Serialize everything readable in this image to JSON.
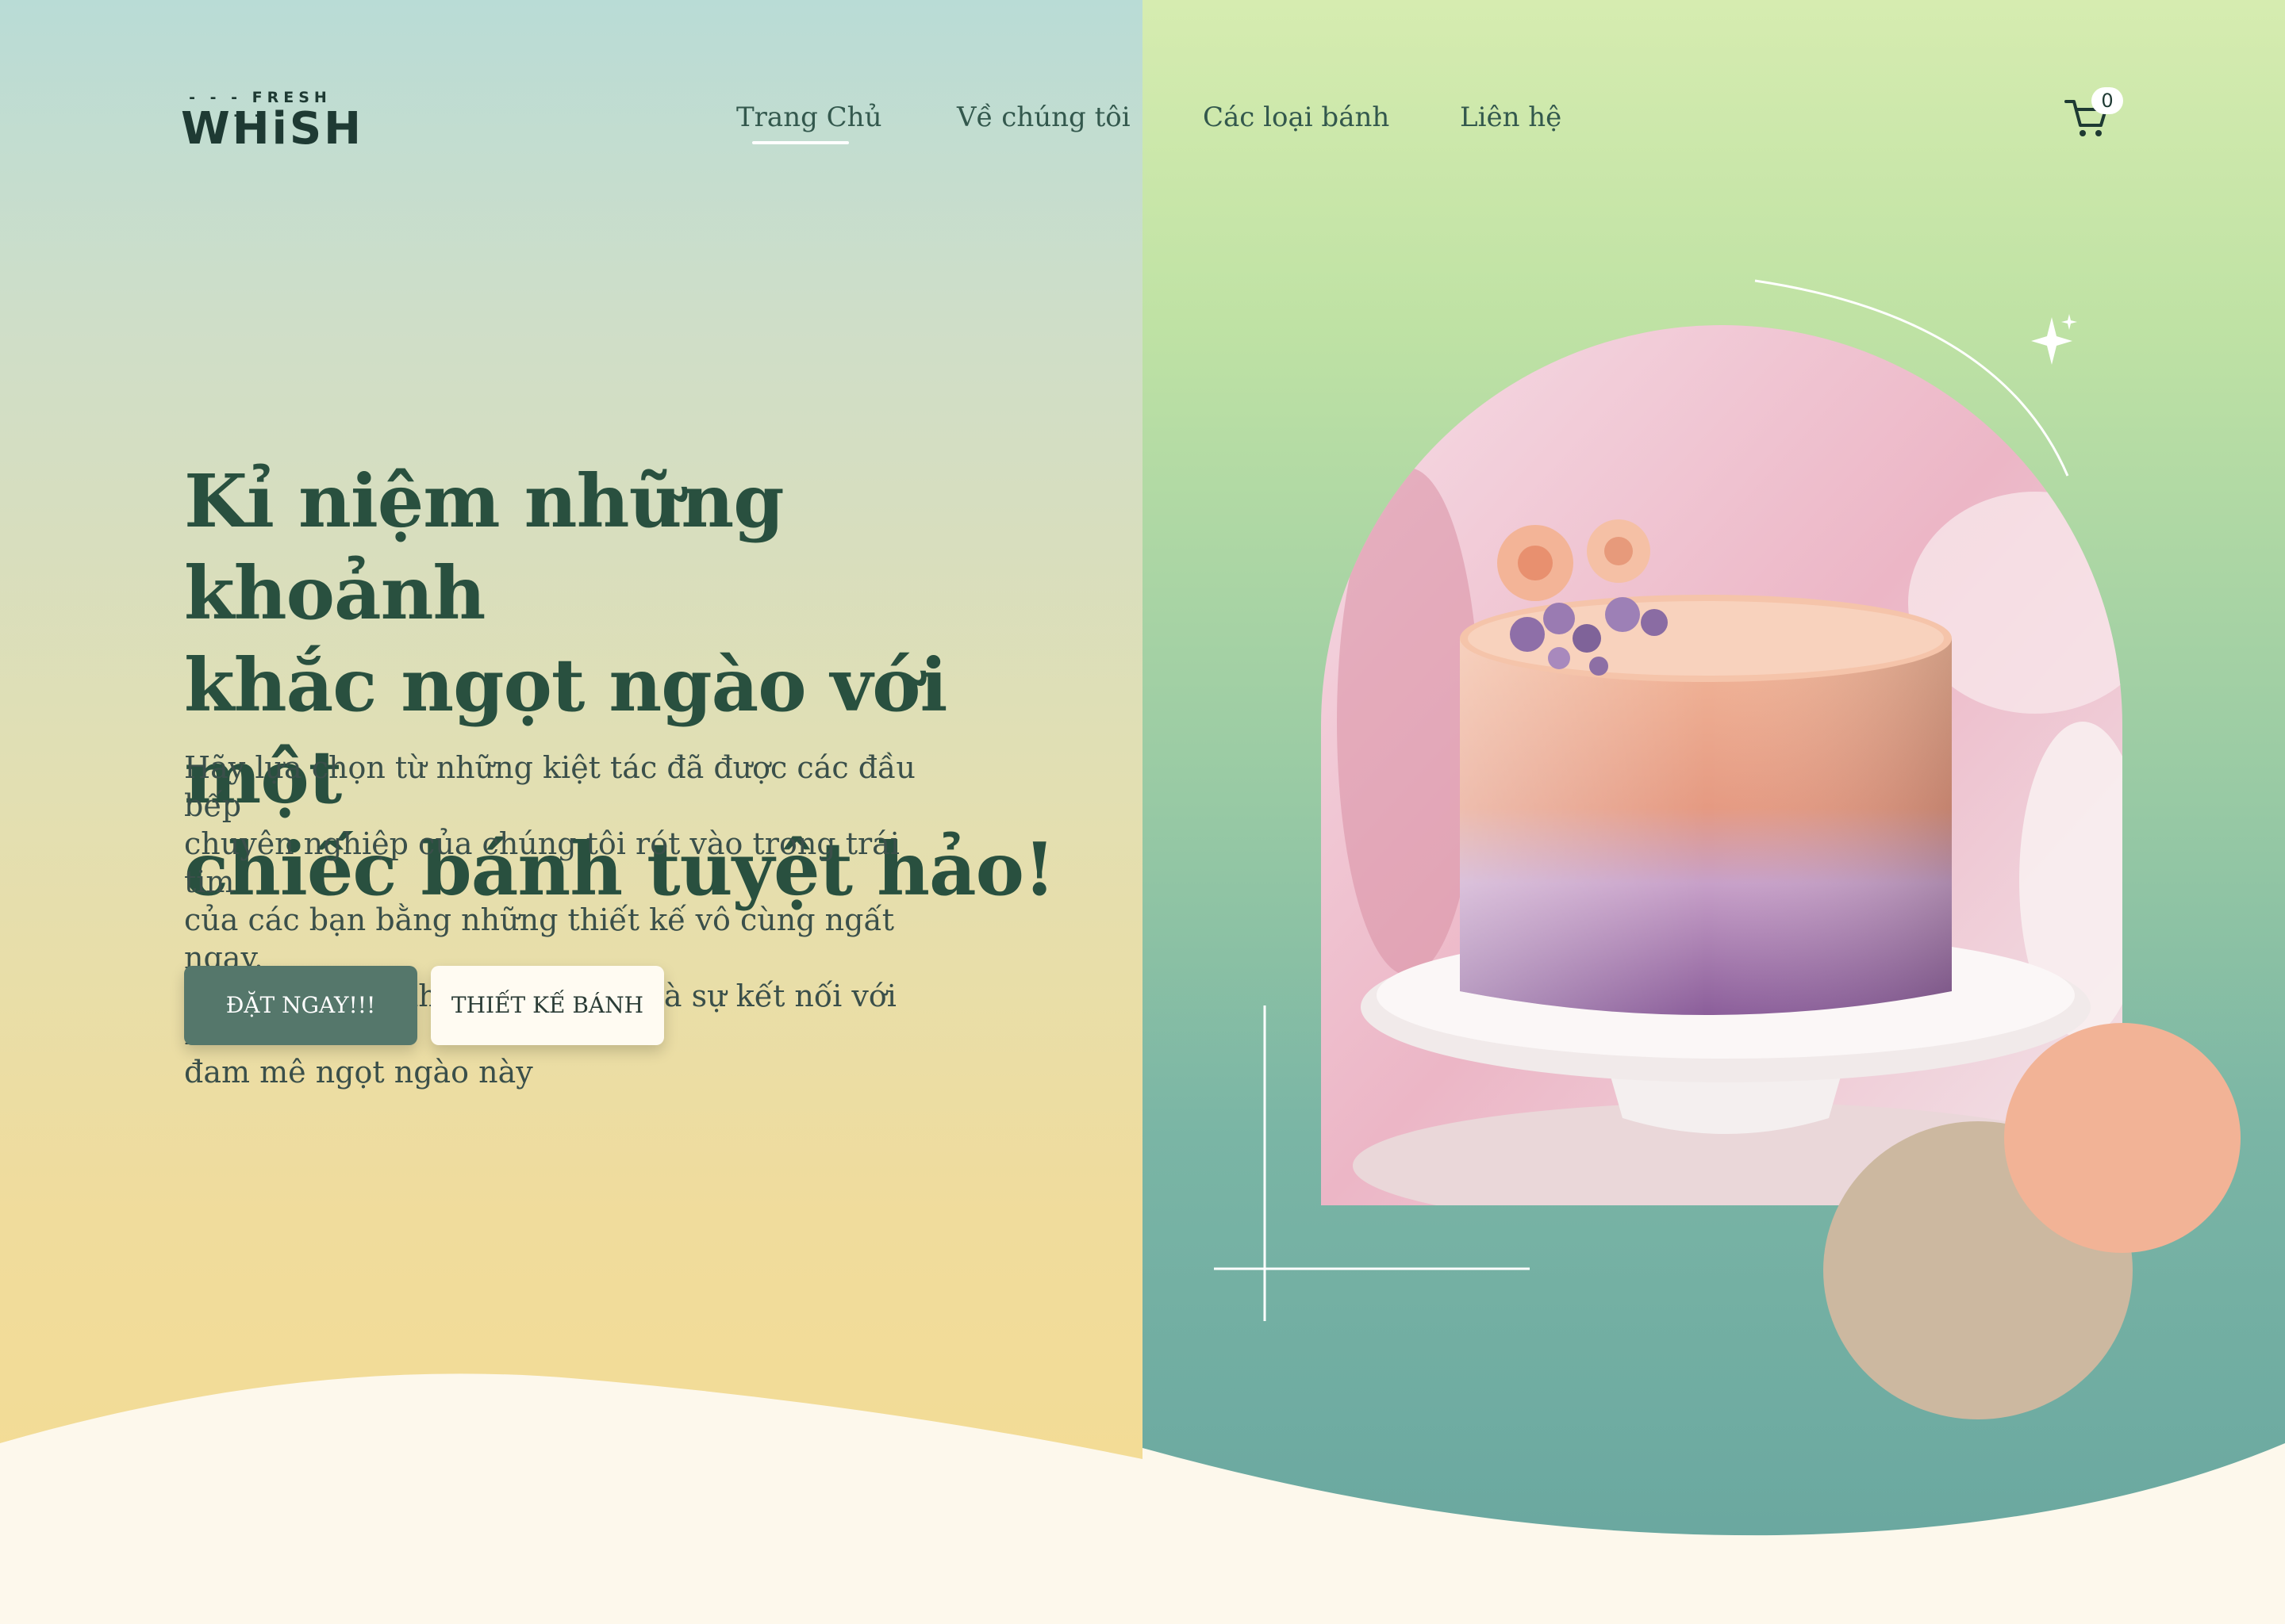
{
  "brand": {
    "tagline": "FRESH",
    "name": "WHiSH"
  },
  "nav": {
    "items": [
      {
        "label": "Trang Chủ",
        "active": true
      },
      {
        "label": "Về chúng tôi",
        "active": false
      },
      {
        "label": "Các loại bánh",
        "active": false
      },
      {
        "label": "Liên hệ",
        "active": false
      }
    ]
  },
  "cart": {
    "icon": "cart-icon",
    "count": "0"
  },
  "hero": {
    "headline_lines": [
      "Kỉ niệm những khoảnh",
      "khắc ngọt ngào với một",
      "chiếc bánh tuyệt hảo!"
    ],
    "subtext_lines": [
      "Hãy lựa chọn từ những kiệt tác đã được các đầu bếp",
      "chuyên nghiệp của chúng tôi rót vào trong trái tim",
      "của các bạn bằng những thiết kế vô cùng ngất ngay.",
      "Cùng tạo nên những niềm vui và sự kết nối với niềm",
      "đam mê ngọt ngào này"
    ],
    "primary_button": "ĐẶT NGAY!!!",
    "secondary_button": "THIẾT KẾ BÁNH"
  },
  "colors": {
    "heading": "#29503f",
    "primary_button": "#55776b",
    "secondary_button": "#fffbf2",
    "peach_circle": "#f2b396",
    "tan_circle": "#ccb8a0",
    "cream": "#fdf8ec"
  }
}
